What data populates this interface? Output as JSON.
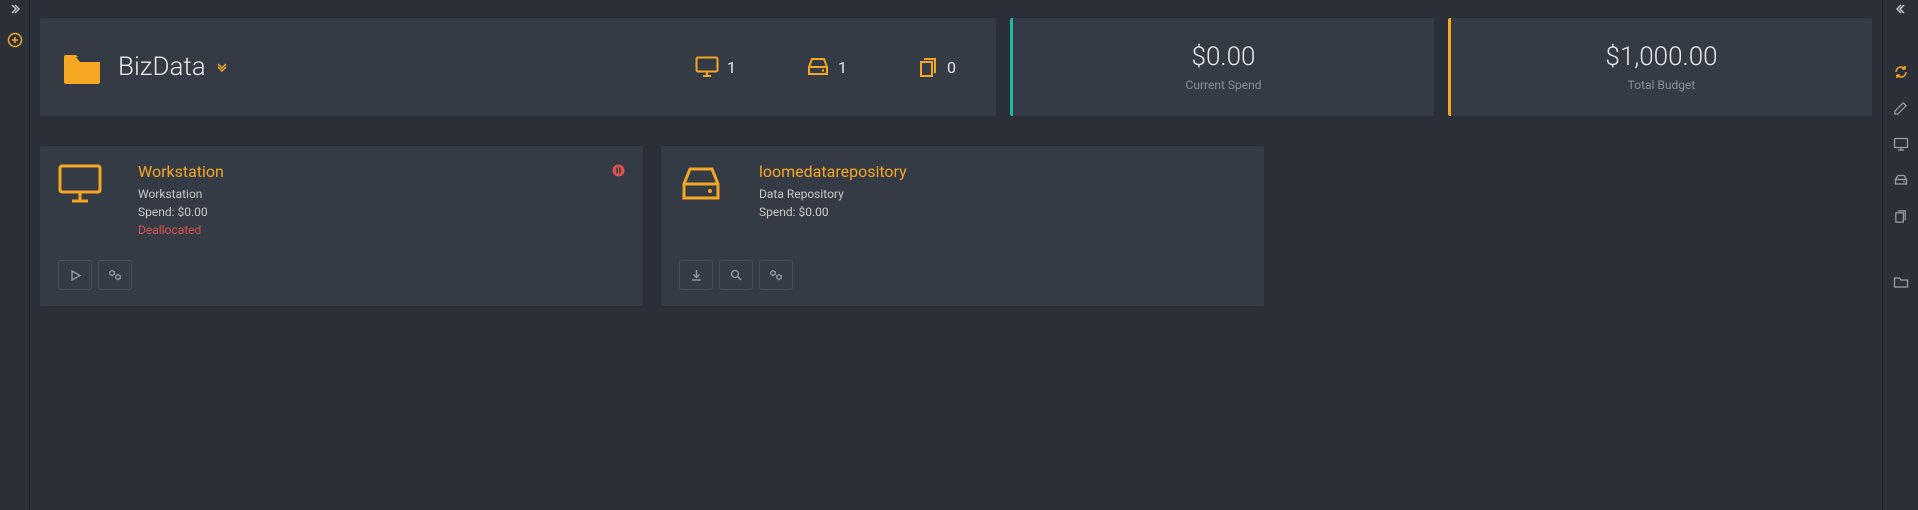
{
  "project": {
    "name": "BizData"
  },
  "stats": {
    "workstations": "1",
    "storage": "1",
    "other": "0"
  },
  "metrics": {
    "spend_value": "$0.00",
    "spend_label": "Current Spend",
    "budget_value": "$1,000.00",
    "budget_label": "Total Budget"
  },
  "cards": {
    "workstation": {
      "title": "Workstation",
      "type": "Workstation",
      "spend": "Spend: $0.00",
      "status": "Deallocated"
    },
    "repo": {
      "title": "loomedatarepository",
      "type": "Data Repository",
      "spend": "Spend: $0.00"
    }
  }
}
